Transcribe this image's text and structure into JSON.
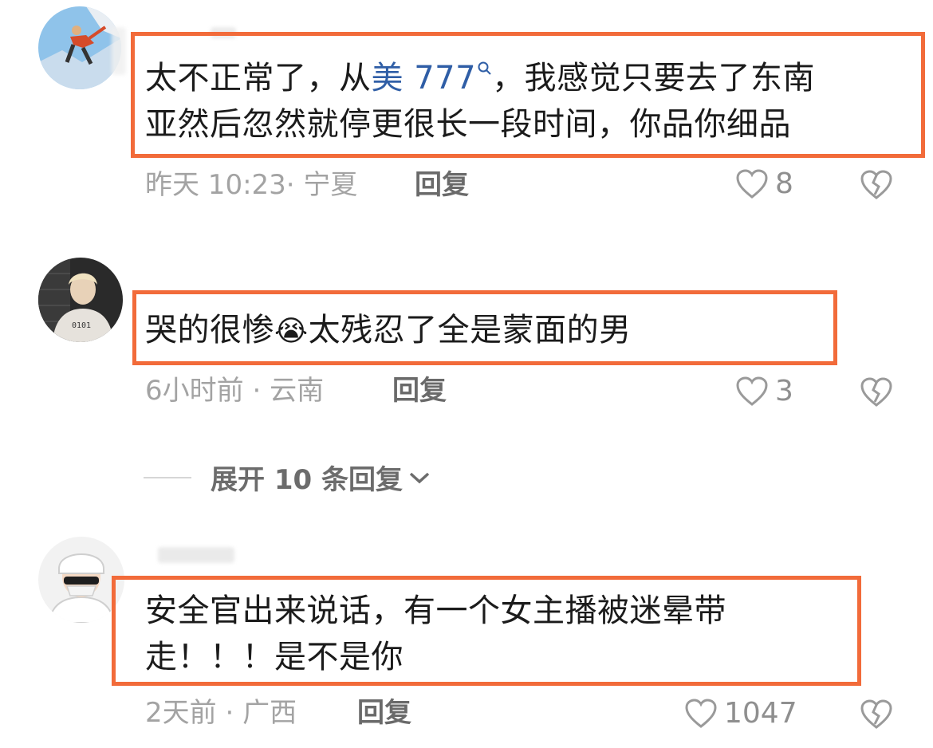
{
  "comments": [
    {
      "text_line1_before": "太不正常了，从",
      "link_text": "美 777",
      "text_line1_after": "，我感觉只要去了东南",
      "text_line2": "亚然后忽然就停更很长一段时间，你品你细品",
      "time": "昨天 10:23",
      "location": "宁夏",
      "reply": "回复",
      "likes": "8",
      "icons": [
        "heart-outline-icon",
        "broken-heart-icon",
        "search-icon"
      ]
    },
    {
      "text_before": "哭的很惨",
      "emoji": "😭",
      "text_after": "太残忍了全是蒙面的男",
      "time": "6小时前",
      "location": "云南",
      "reply": "回复",
      "likes": "3",
      "icons": [
        "heart-outline-icon",
        "broken-heart-icon"
      ]
    },
    {
      "text_line1": "安全官出来说话，有一个女主播被迷晕带",
      "text_line2": "走！！！是不是你",
      "time": "2天前",
      "location": "广西",
      "reply": "回复",
      "likes": "1047",
      "icons": [
        "heart-outline-icon",
        "broken-heart-icon"
      ]
    }
  ],
  "expand_replies": "展开 10 条回复",
  "separator": "·",
  "colors": {
    "highlight_border": "#f26b3a",
    "link": "#2f5ea6",
    "meta": "#a3a3a3"
  }
}
